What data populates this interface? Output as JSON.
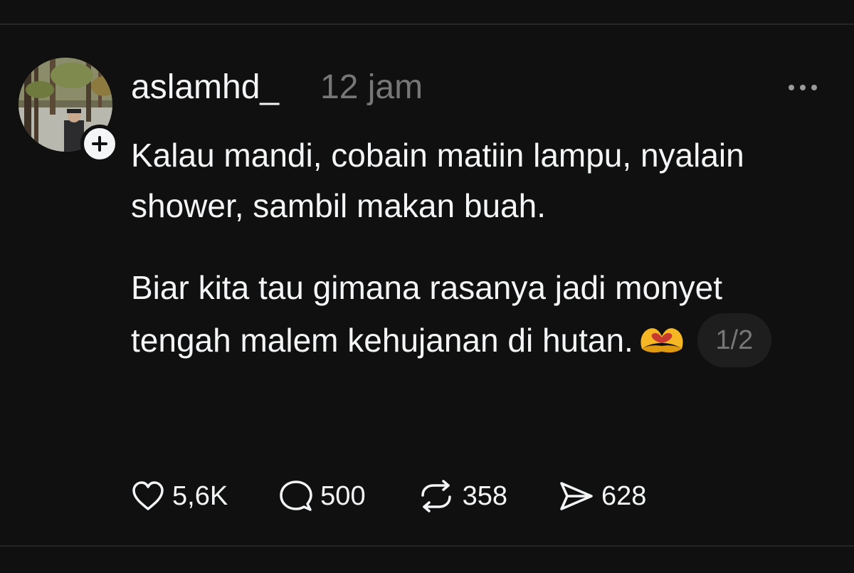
{
  "post": {
    "username": "aslamhd_",
    "timestamp": "12 jam",
    "paragraphs": [
      "Kalau mandi, cobain matiin lampu, nyalain shower, sambil makan buah.",
      "Biar kita tau gimana rasanya jadi monyet tengah malem kehujanan di hutan."
    ],
    "emoji": "heart-hands-emoji",
    "page_indicator": "1/2",
    "actions": {
      "likes": "5,6K",
      "replies": "500",
      "reposts": "358",
      "shares": "628"
    }
  },
  "icons": {
    "avatar": "profile-photo",
    "follow": "plus-icon",
    "more": "ellipsis-icon",
    "like": "heart-icon",
    "reply": "comment-icon",
    "repost": "repost-icon",
    "share": "send-icon"
  },
  "colors": {
    "background": "#101010",
    "text": "#f3f5f7",
    "muted": "#777777",
    "divider": "#262626"
  }
}
